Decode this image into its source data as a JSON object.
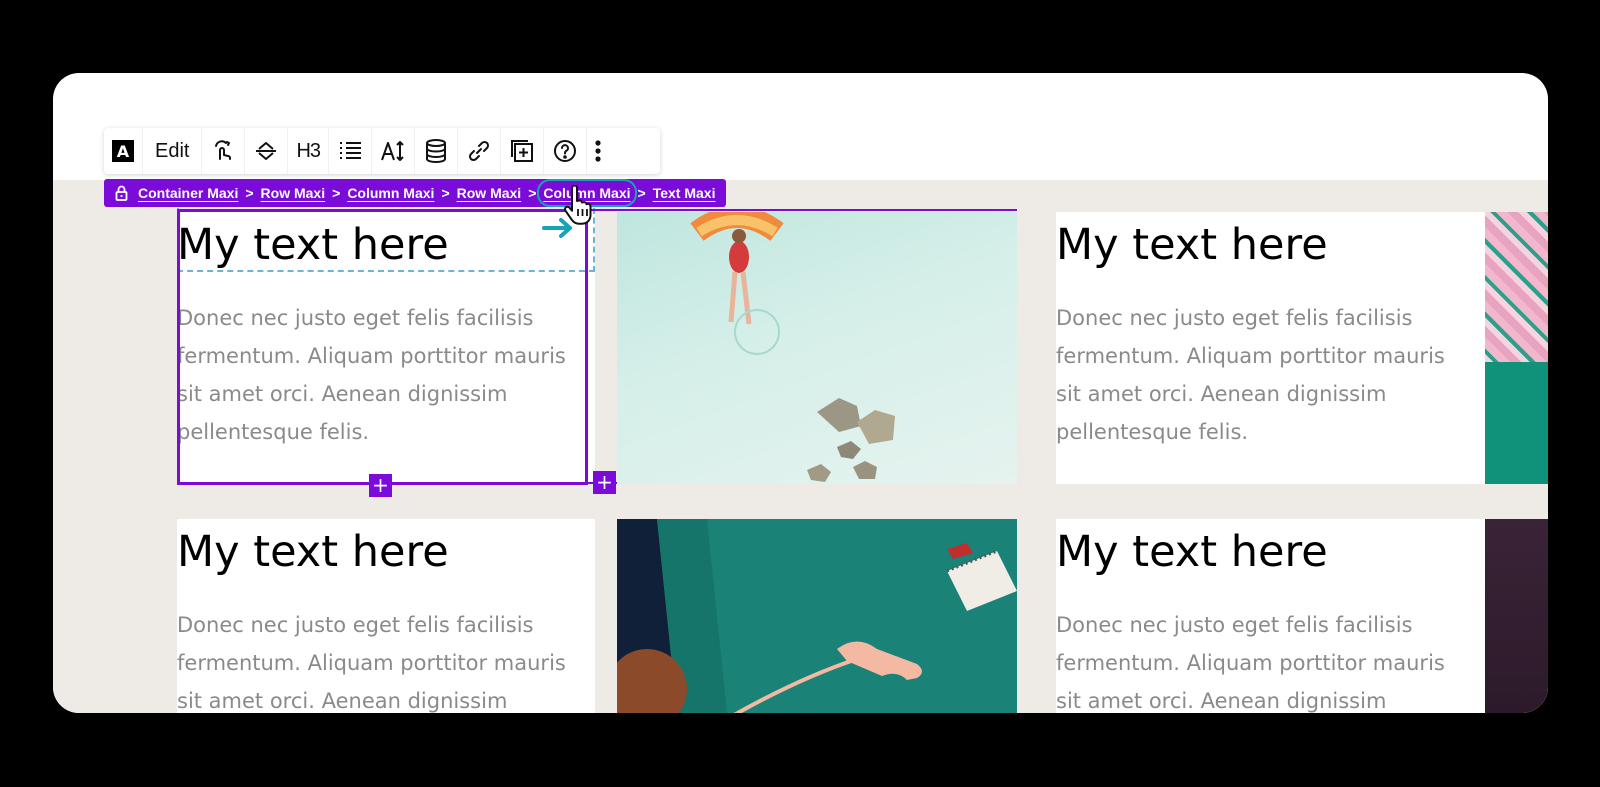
{
  "toolbar": {
    "logo_label": "A",
    "edit_label": "Edit",
    "heading_level": "H3",
    "icons": [
      "logo-icon",
      "edit-text",
      "hand-pointer-icon",
      "alignment-icon",
      "heading-level-icon",
      "list-icon",
      "font-size-icon",
      "database-icon",
      "link-icon",
      "add-block-icon",
      "help-icon",
      "more-options-icon"
    ]
  },
  "breadcrumb": {
    "lock_icon": "lock-icon",
    "separator": ">",
    "items": [
      "Container Maxi",
      "Row Maxi",
      "Column Maxi",
      "Row Maxi",
      "Column Maxi",
      "Text Maxi"
    ],
    "highlighted_index": 4
  },
  "add_button_label": "+",
  "cards": [
    {
      "title": "My text here",
      "body": "Donec nec justo eget felis facilisis fermentum. Aliquam porttitor mauris sit amet orci. Aenean dignissim pellentesque felis.",
      "image": "pool-float-photo"
    },
    {
      "title": "My text here",
      "body": "Donec nec justo eget felis facilisis fermentum. Aliquam porttitor mauris sit amet orci. Aenean dignissim pellentesque felis.",
      "image": "pink-pattern-photo"
    },
    {
      "title": "My text here",
      "body": "Donec nec justo eget felis facilisis fermentum. Aliquam porttitor mauris sit amet orci. Aenean dignissim",
      "image": "teal-sofa-phone-photo"
    },
    {
      "title": "My text here",
      "body": "Donec nec justo eget felis facilisis fermentum. Aliquam porttitor mauris sit amet orci. Aenean dignissim",
      "image": "dark-purple-photo"
    }
  ],
  "colors": {
    "accent": "#7b0bd9",
    "highlight": "#16a3b5",
    "canvas_bg": "#eeebe7",
    "body_text": "#8a8a8a"
  }
}
